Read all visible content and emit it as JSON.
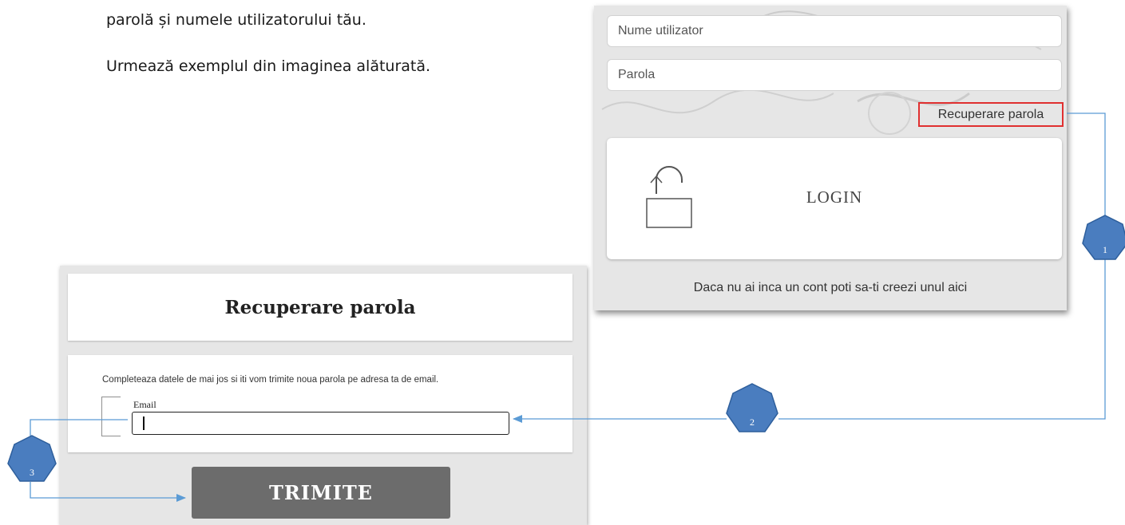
{
  "document": {
    "line1": "parolă și numele utilizatorului tău.",
    "line2": "Urmează exemplul din imaginea alăturată."
  },
  "login": {
    "username_placeholder": "Nume utilizator",
    "password_placeholder": "Parola",
    "recover_link": "Recuperare parola",
    "login_label": "LOGIN",
    "signup_text": "Daca nu ai inca un cont poti sa-ti creezi unul aici",
    "icons": {
      "lock": "unlocked-padlock-icon"
    }
  },
  "recovery": {
    "title": "Recuperare parola",
    "instructions": "Completeaza datele de mai jos si iti vom trimite noua parola pe adresa ta de email.",
    "email_label": "Email",
    "email_value": "",
    "submit_label": "TRIMITE"
  },
  "annotations": {
    "badge_1": "1",
    "badge_2": "2",
    "badge_3": "3",
    "badge_color": "#4a7dbf",
    "badge_border": "#2e5f9c",
    "arrow_color": "#5b9bd5",
    "highlight_color": "#e03030"
  }
}
